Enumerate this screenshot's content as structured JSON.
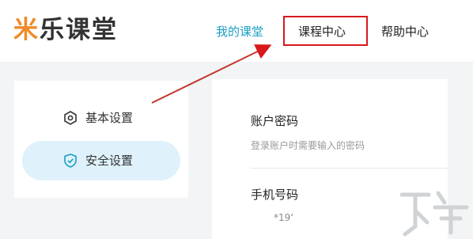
{
  "header": {
    "logo": {
      "part1": "米",
      "part2": "乐课堂"
    },
    "nav": [
      {
        "label": "我的课堂",
        "active": true
      },
      {
        "label": "课程中心",
        "active": false,
        "highlighted": true
      },
      {
        "label": "帮助中心",
        "active": false
      }
    ]
  },
  "sidebar": {
    "items": [
      {
        "label": "基本设置",
        "icon": "settings-hex-icon"
      },
      {
        "label": "安全设置",
        "icon": "shield-check-icon",
        "selected": true
      }
    ]
  },
  "main": {
    "account_password": {
      "title": "账户密码",
      "subtitle": "登录账户时需要输入的密码"
    },
    "phone": {
      "title": "手机号码",
      "value": "*19‘"
    }
  },
  "colors": {
    "accent": "#1a9fc0",
    "logo_accent": "#f08a28",
    "highlight": "#d7191c",
    "selected_bg": "#dff1fb"
  }
}
